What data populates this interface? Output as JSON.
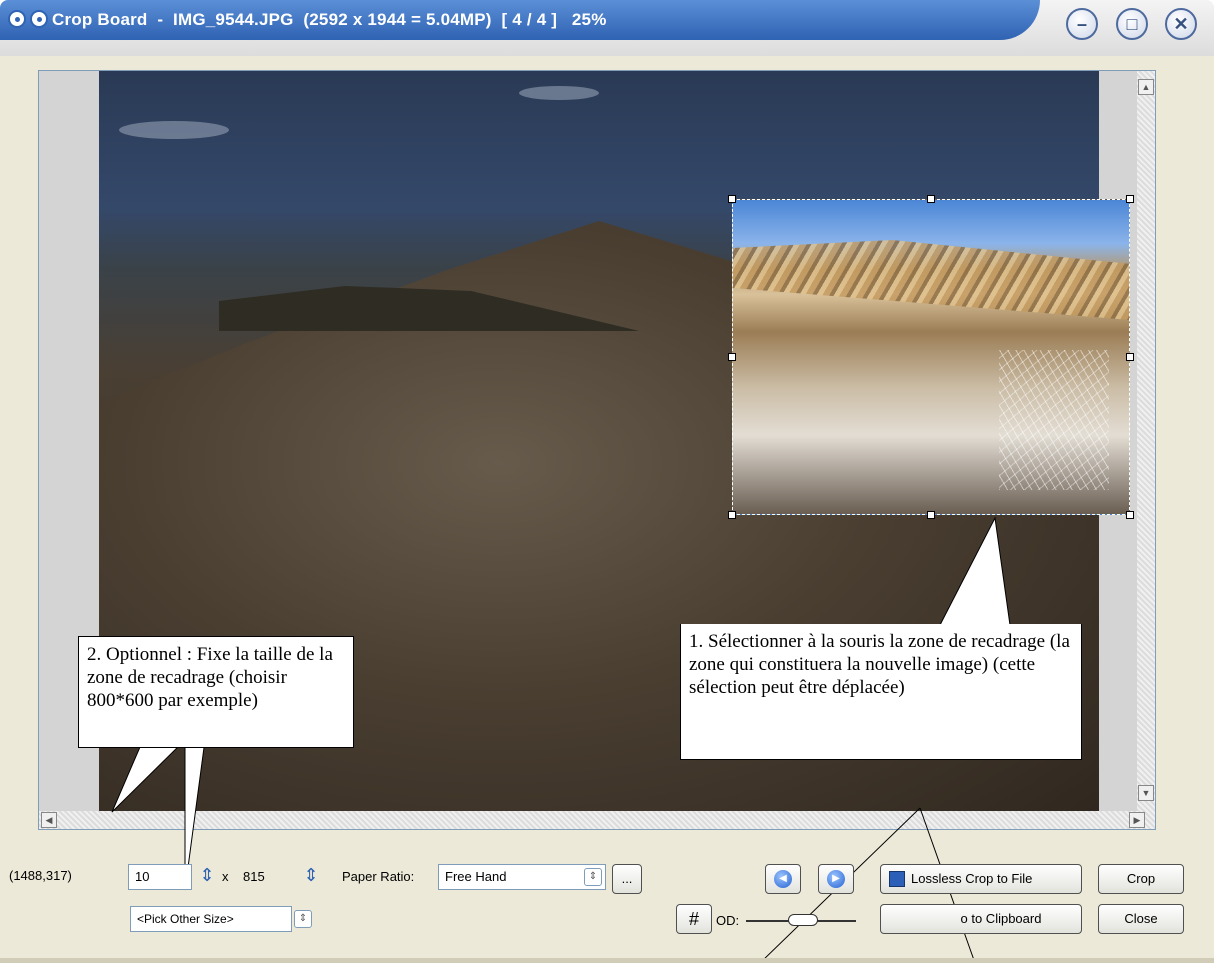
{
  "window": {
    "title": "Crop Board  -  IMG_9544.JPG  (2592 x 1944 = 5.04MP)  [ 4 / 4 ]   25%"
  },
  "controls": {
    "coords": "(1488,317)",
    "width_value": "10",
    "times": "x",
    "height_value": "815",
    "paper_ratio_label": "Paper Ratio:",
    "paper_ratio_value": "Free Hand",
    "more_label": "...",
    "pick_other_size": "<Pick Other Size>",
    "grid_label": "#",
    "od_label": "OD:",
    "lossless_crop_label": "Lossless Crop to File",
    "crop_label": "Crop",
    "clipboard_label": "o to Clipboard",
    "close_label": "Close"
  },
  "callouts": {
    "step1": "1. Sélectionner à la souris la zone de recadrage (la zone qui constituera la nouvelle image) (cette sélection peut être déplacée)",
    "step2": "2. Optionnel : Fixe la taille de la zone de recadrage (choisir 800*600 par exemple)"
  },
  "icons": {
    "prev": "prev-arrow-icon",
    "next": "next-arrow-icon",
    "save": "floppy-disk-icon"
  }
}
